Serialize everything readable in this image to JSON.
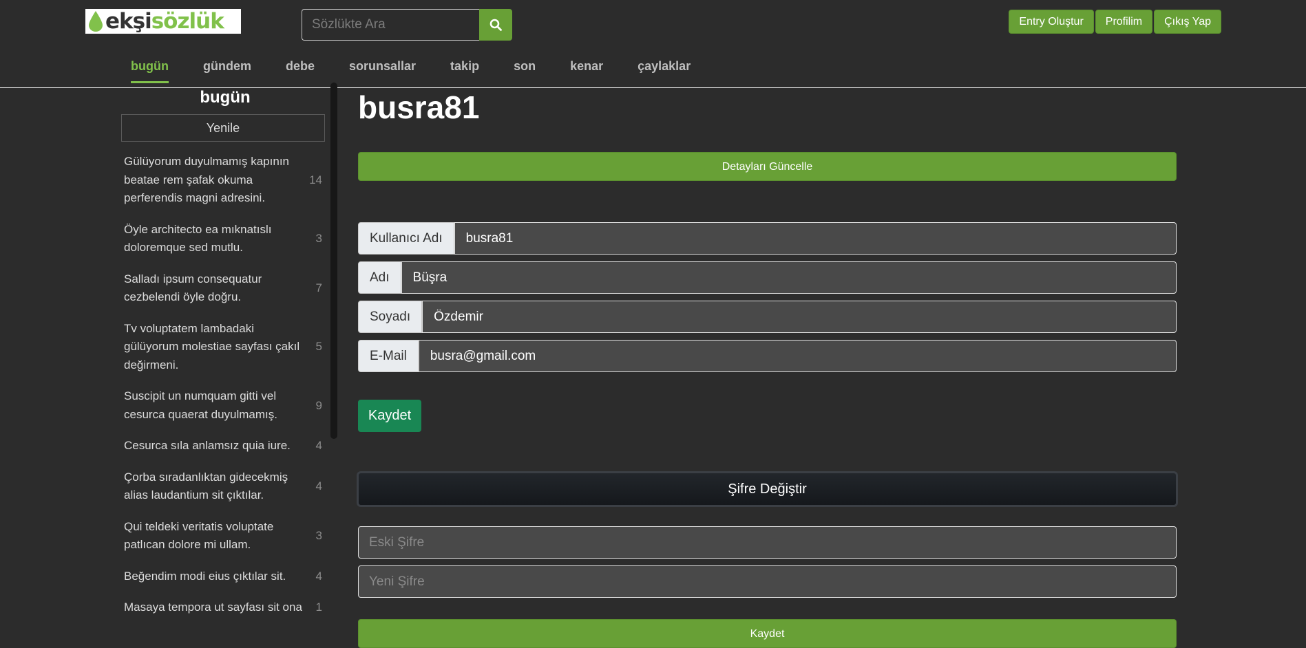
{
  "header": {
    "logo": {
      "part1": "ekşi",
      "part2": "sözlük"
    },
    "search": {
      "placeholder": "Sözlükte Ara",
      "icon": "search-icon"
    },
    "buttons": {
      "create_entry": "Entry Oluştur",
      "profile": "Profilim",
      "logout": "Çıkış Yap"
    }
  },
  "nav": {
    "active": "bugün",
    "items": [
      "bugün",
      "gündem",
      "debe",
      "sorunsallar",
      "takip",
      "son",
      "kenar",
      "çaylaklar"
    ]
  },
  "sidebar": {
    "title": "bugün",
    "refresh_label": "Yenile",
    "topics": [
      {
        "title": "Gülüyorum duyulmamış kapının beatae rem şafak okuma perferendis magni adresini.",
        "count": "14"
      },
      {
        "title": "Öyle architecto ea mıknatıslı doloremque sed mutlu.",
        "count": "3"
      },
      {
        "title": "Salladı ipsum consequatur cezbelendi öyle doğru.",
        "count": "7"
      },
      {
        "title": "Tv voluptatem lambadaki gülüyorum molestiae sayfası çakıl değirmeni.",
        "count": "5"
      },
      {
        "title": "Suscipit un numquam gitti vel cesurca quaerat duyulmamış.",
        "count": "9"
      },
      {
        "title": "Cesurca sıla anlamsız quia iure.",
        "count": "4"
      },
      {
        "title": "Çorba sıradanlıktan gidecekmiş alias laudantium sit çıktılar.",
        "count": "4"
      },
      {
        "title": "Qui teldeki veritatis voluptate patlıcan dolore mi ullam.",
        "count": "3"
      },
      {
        "title": "Beğendim modi eius çıktılar sit.",
        "count": "4"
      },
      {
        "title": "Masaya tempora ut sayfası sit ona",
        "count": "1"
      }
    ]
  },
  "main": {
    "username": "busra81",
    "update_details_label": "Detayları Güncelle",
    "fields": [
      {
        "label": "Kullanıcı Adı",
        "value": "busra81"
      },
      {
        "label": "Adı",
        "value": "Büşra"
      },
      {
        "label": "Soyadı",
        "value": "Özdemir"
      },
      {
        "label": "E-Mail",
        "value": "busra@gmail.com"
      }
    ],
    "save_label": "Kaydet",
    "change_password_label": "Şifre Değiştir",
    "old_password_placeholder": "Eski Şifre",
    "new_password_placeholder": "Yeni Şifre",
    "password_save_label": "Kaydet"
  },
  "colors": {
    "background": "#2c2c2c",
    "brand_green": "#68a036",
    "logo_green": "#81c14b",
    "save_green": "#198754"
  }
}
